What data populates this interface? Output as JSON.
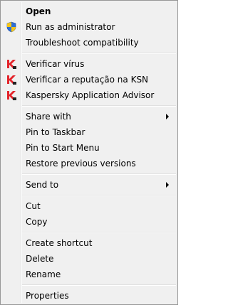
{
  "context_menu": {
    "open_label": "Open",
    "run_as_admin_label": "Run as administrator",
    "troubleshoot_label": "Troubleshoot compatibility",
    "verificar_virus_label": "Verificar vírus",
    "verificar_reputacao_label": "Verificar a reputação na KSN",
    "kaspersky_advisor_label": "Kaspersky Application Advisor",
    "share_with_label": "Share with",
    "pin_taskbar_label": "Pin to Taskbar",
    "pin_start_label": "Pin to Start Menu",
    "restore_versions_label": "Restore previous versions",
    "send_to_label": "Send to",
    "cut_label": "Cut",
    "copy_label": "Copy",
    "create_shortcut_label": "Create shortcut",
    "delete_label": "Delete",
    "rename_label": "Rename",
    "properties_label": "Properties"
  },
  "icons": {
    "shield": "uac-shield-icon",
    "kaspersky": "kaspersky-icon",
    "submenu": "chevron-right-icon"
  },
  "colors": {
    "menu_background": "#f0f0f0",
    "menu_border": "#979797",
    "kaspersky_red": "#e3242b",
    "uac_blue": "#2f6fd6",
    "uac_yellow": "#f5c518"
  }
}
